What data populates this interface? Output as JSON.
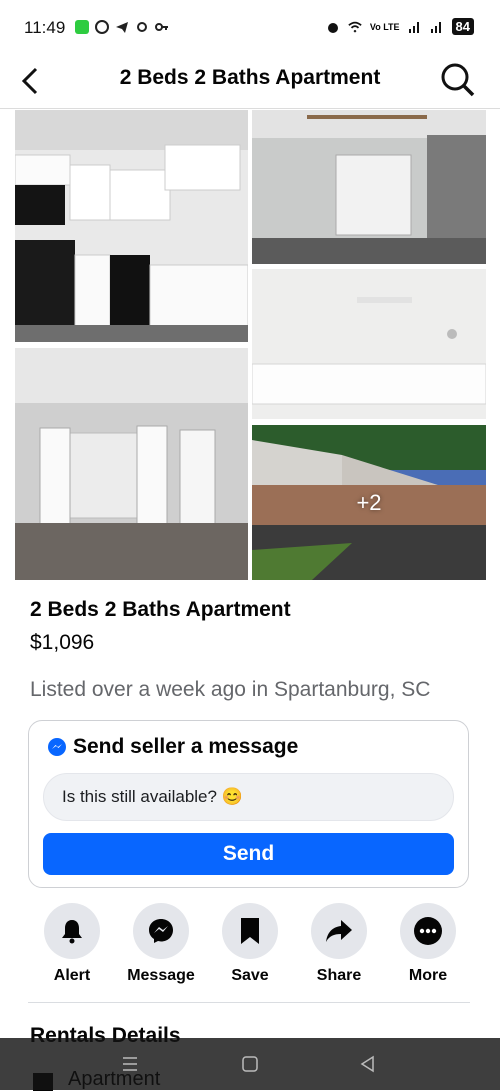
{
  "status_bar": {
    "time": "11:49",
    "signal_label": "Vo LTE",
    "battery": "84"
  },
  "header": {
    "title": "2 Beds 2 Baths Apartment"
  },
  "photos": {
    "more_count": "+2"
  },
  "listing": {
    "title": "2 Beds 2 Baths Apartment",
    "price": "$1,096",
    "meta": "Listed over a week ago in Spartanburg, SC"
  },
  "message": {
    "heading": "Send seller a message",
    "input_value": "Is this still available? 😊",
    "send_label": "Send"
  },
  "actions": [
    {
      "label": "Alert",
      "icon": "bell-icon"
    },
    {
      "label": "Message",
      "icon": "messenger-icon"
    },
    {
      "label": "Save",
      "icon": "bookmark-icon"
    },
    {
      "label": "Share",
      "icon": "share-icon"
    },
    {
      "label": "More",
      "icon": "more-icon"
    }
  ],
  "details": {
    "section_title": "Rentals Details",
    "type": "Apartment"
  },
  "colors": {
    "accent": "#0866ff",
    "secondary_text": "#65676b",
    "action_bg": "#e4e6eb"
  }
}
